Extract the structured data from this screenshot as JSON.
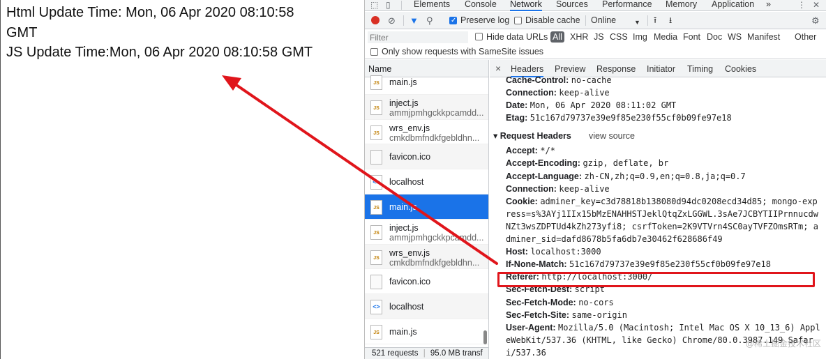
{
  "page": {
    "html_update_line1": "Html Update Time: Mon, 06 Apr 2020 08:10:58",
    "html_update_line2": "GMT",
    "js_update_line": "JS Update Time:Mon, 06 Apr 2020 08:10:58 GMT"
  },
  "devtools": {
    "tabs": {
      "elements": "Elements",
      "console": "Console",
      "network": "Network",
      "sources": "Sources",
      "performance": "Performance",
      "memory": "Memory",
      "application": "Application",
      "more": "»"
    },
    "toolbar": {
      "preserve_log": "Preserve log",
      "disable_cache": "Disable cache",
      "throttling": "Online"
    },
    "filter": {
      "placeholder": "Filter",
      "hide_data_urls": "Hide data URLs",
      "types": [
        "All",
        "XHR",
        "JS",
        "CSS",
        "Img",
        "Media",
        "Font",
        "Doc",
        "WS",
        "Manifest",
        "Other"
      ]
    },
    "samesite_label": "Only show requests with SameSite issues",
    "name_header": "Name",
    "requests": [
      {
        "name": "main.js",
        "sub": "",
        "icon": "JS"
      },
      {
        "name": "inject.js",
        "sub": "ammjpmhgckkpcamdd...",
        "icon": "JS"
      },
      {
        "name": "wrs_env.js",
        "sub": "cmkdbmfndkfgebldhn...",
        "icon": "JS"
      },
      {
        "name": "favicon.ico",
        "sub": "",
        "icon": "plain"
      },
      {
        "name": "localhost",
        "sub": "",
        "icon": "html"
      },
      {
        "name": "main.js",
        "sub": "",
        "icon": "JS"
      },
      {
        "name": "inject.js",
        "sub": "ammjpmhgckkpcamdd...",
        "icon": "JS"
      },
      {
        "name": "wrs_env.js",
        "sub": "cmkdbmfndkfgebldhn...",
        "icon": "JS"
      },
      {
        "name": "favicon.ico",
        "sub": "",
        "icon": "plain"
      },
      {
        "name": "localhost",
        "sub": "",
        "icon": "html"
      },
      {
        "name": "main.js",
        "sub": "",
        "icon": "JS"
      }
    ],
    "status": {
      "requests": "521 requests",
      "transferred": "95.0 MB transf"
    },
    "detail_tabs": {
      "close": "×",
      "headers": "Headers",
      "preview": "Preview",
      "response": "Response",
      "initiator": "Initiator",
      "timing": "Timing",
      "cookies": "Cookies"
    },
    "response_headers": {
      "cache_control_key": "Cache-Control:",
      "cache_control_val": "no-cache",
      "connection_key": "Connection:",
      "connection_val": "keep-alive",
      "date_key": "Date:",
      "date_val": "Mon, 06 Apr 2020 08:11:02 GMT",
      "etag_key": "Etag:",
      "etag_val": "51c167d79737e39e9f85e230f55cf0b09fe97e18"
    },
    "request_headers_title": "▾ Request Headers",
    "view_source": "view source",
    "request_headers": {
      "accept_key": "Accept:",
      "accept_val": "*/*",
      "accept_encoding_key": "Accept-Encoding:",
      "accept_encoding_val": "gzip, deflate, br",
      "accept_language_key": "Accept-Language:",
      "accept_language_val": "zh-CN,zh;q=0.9,en;q=0.8,ja;q=0.7",
      "connection_key": "Connection:",
      "connection_val": "keep-alive",
      "cookie_key": "Cookie:",
      "cookie_val_1": "adminer_key=c3d78818b138080d94dc0208ecd34d85; mongo-exp",
      "cookie_val_2": "ress=s%3AYj1IIx15bMzENAHHSTJeklQtqZxLGGWL.3sAe7JCBYTIIPrnnucdw",
      "cookie_val_3": "NZt3wsZDPTUd4kZh273yfi8; csrfToken=2K9VTVrn4SC0ayTVFZOmsRTm; a",
      "cookie_val_4": "dminer_sid=dafd8678b5fa6db7e30462f628686f49",
      "host_key": "Host:",
      "host_val": "localhost:3000",
      "if_none_match_key": "If-None-Match:",
      "if_none_match_val": "51c167d79737e39e9f85e230f55cf0b09fe97e18",
      "referer_key": "Referer:",
      "referer_val": "http://localhost:3000/",
      "sec_fetch_dest_key": "Sec-Fetch-Dest:",
      "sec_fetch_dest_val": "script",
      "sec_fetch_mode_key": "Sec-Fetch-Mode:",
      "sec_fetch_mode_val": "no-cors",
      "sec_fetch_site_key": "Sec-Fetch-Site:",
      "sec_fetch_site_val": "same-origin",
      "user_agent_key": "User-Agent:",
      "user_agent_val_1": "Mozilla/5.0 (Macintosh; Intel Mac OS X 10_13_6) Appl",
      "user_agent_val_2": "eWebKit/537.36 (KHTML, like Gecko) Chrome/80.0.3987.149 Safar",
      "user_agent_val_3": "i/537.36"
    },
    "watermark": "@稀土掘金技术社区"
  },
  "colors": {
    "accent": "#1a73e8",
    "record": "#d93025",
    "annotation": "#e0151b"
  }
}
